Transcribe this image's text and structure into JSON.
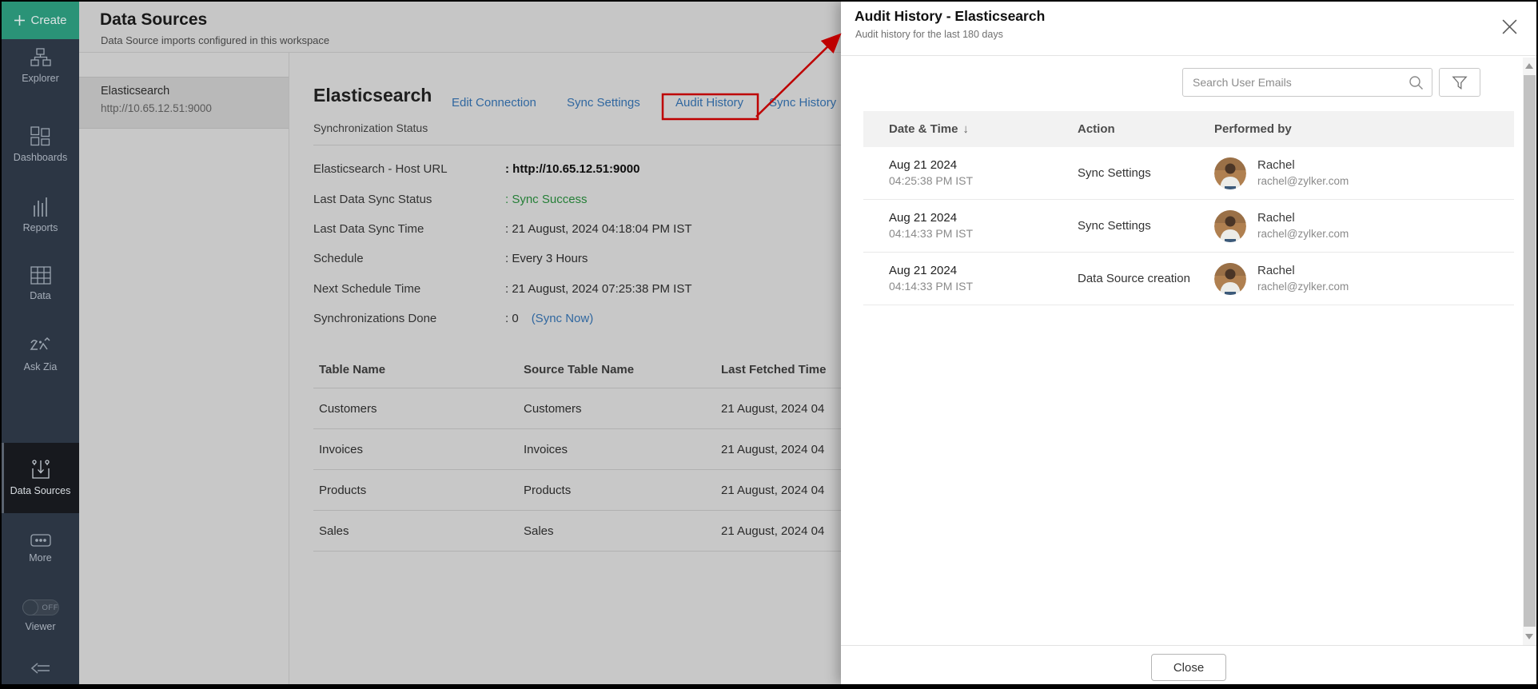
{
  "colors": {
    "accent_green": "#2A9377",
    "sidebar_bg": "#2C3644",
    "link_blue": "#3B7EC3",
    "success_green": "#2E9B44",
    "annotation_red": "#BE0000"
  },
  "sidebar": {
    "create_label": "Create",
    "items": [
      {
        "label": "Explorer",
        "icon": "explorer-icon"
      },
      {
        "label": "Dashboards",
        "icon": "dashboards-icon"
      },
      {
        "label": "Reports",
        "icon": "reports-icon"
      },
      {
        "label": "Data",
        "icon": "data-icon"
      },
      {
        "label": "Ask Zia",
        "icon": "ask-zia-icon"
      },
      {
        "label": "Data Sources",
        "icon": "data-sources-icon",
        "active": true
      },
      {
        "label": "More",
        "icon": "more-icon"
      }
    ],
    "viewer_toggle": {
      "label": "Viewer",
      "state": "OFF"
    }
  },
  "main": {
    "header": {
      "title": "Data Sources",
      "subtitle": "Data Source imports configured in this workspace"
    },
    "source_list": [
      {
        "name": "Elasticsearch",
        "url": "http://10.65.12.51:9000",
        "selected": true
      }
    ],
    "detail": {
      "title": "Elasticsearch",
      "links": [
        "Edit Connection",
        "Sync Settings",
        "Audit History",
        "Sync History"
      ],
      "section_title": "Synchronization Status",
      "fields": [
        {
          "label": "Elasticsearch - Host URL",
          "value": ": http://10.65.12.51:9000"
        },
        {
          "label": "Last Data Sync Status",
          "value": ": Sync Success"
        },
        {
          "label": "Last Data Sync Time",
          "value": ": 21 August, 2024 04:18:04 PM IST"
        },
        {
          "label": "Schedule",
          "value": ": Every 3 Hours"
        },
        {
          "label": "Next Schedule Time",
          "value": ": 21 August, 2024 07:25:38 PM IST"
        },
        {
          "label": "Synchronizations Done",
          "value": ": 0"
        }
      ],
      "sync_now_link": "(Sync Now)",
      "table": {
        "columns": [
          "Table Name",
          "Source Table Name",
          "Last Fetched Time"
        ],
        "rows": [
          [
            "Customers",
            "Customers",
            "21 August, 2024 04"
          ],
          [
            "Invoices",
            "Invoices",
            "21 August, 2024 04"
          ],
          [
            "Products",
            "Products",
            "21 August, 2024 04"
          ],
          [
            "Sales",
            "Sales",
            "21 August, 2024 04"
          ]
        ]
      }
    }
  },
  "panel": {
    "title": "Audit History - Elasticsearch",
    "subtitle": "Audit history for the last 180 days",
    "search_placeholder": "Search User Emails",
    "table": {
      "columns": [
        "Date & Time",
        "Action",
        "Performed by"
      ],
      "sort_indicator": "↓",
      "rows": [
        {
          "date": "Aug 21 2024",
          "time": "04:25:38 PM IST",
          "action": "Sync Settings",
          "user": "Rachel",
          "email": "rachel@zylker.com"
        },
        {
          "date": "Aug 21 2024",
          "time": "04:14:33 PM IST",
          "action": "Sync Settings",
          "user": "Rachel",
          "email": "rachel@zylker.com"
        },
        {
          "date": "Aug 21 2024",
          "time": "04:14:33 PM IST",
          "action": "Data Source creation",
          "user": "Rachel",
          "email": "rachel@zylker.com"
        }
      ]
    },
    "close_button": "Close"
  }
}
